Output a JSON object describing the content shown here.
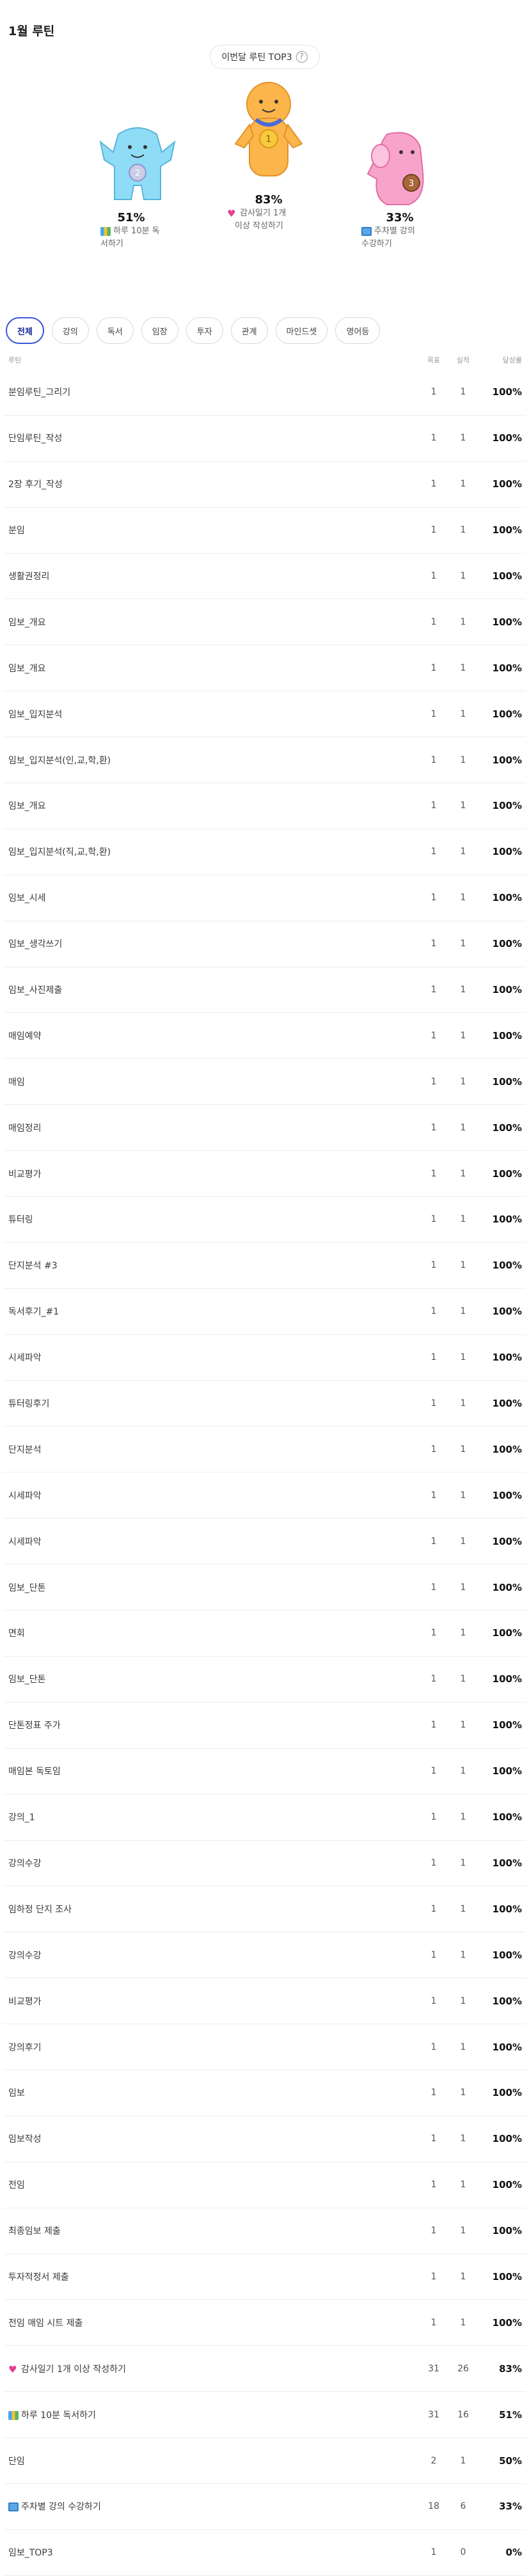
{
  "page_title": "1월 루틴",
  "top3": {
    "pill_label": "이번달 루틴 TOP3",
    "info_icon": "info-icon",
    "first": {
      "rank": "1",
      "percent": "83%",
      "label_line1": "감사일기 1개",
      "label_line2": "이상 작성하기",
      "emoji": "heart",
      "color": "#f5a93a"
    },
    "second": {
      "rank": "2",
      "percent": "51%",
      "label_line1": "하루 10분 독",
      "label_line2": "서하기",
      "emoji": "books",
      "color": "#7fd3f2"
    },
    "third": {
      "rank": "3",
      "percent": "33%",
      "label_line1": "주차별 강의",
      "label_line2": "수강하기",
      "emoji": "screen",
      "color": "#f59ac7"
    }
  },
  "filters": [
    "전체",
    "강의",
    "독서",
    "임장",
    "투자",
    "관계",
    "마인드셋",
    "영어등"
  ],
  "active_filter": "전체",
  "table": {
    "headers": {
      "name": "루틴",
      "goal": "목표",
      "done": "실적",
      "rate": "달성률"
    },
    "rows": [
      {
        "name": "분임루틴_그리기",
        "goal": "1",
        "done": "1",
        "rate": "100%"
      },
      {
        "name": "단임루틴_작성",
        "goal": "1",
        "done": "1",
        "rate": "100%"
      },
      {
        "name": "2장 후기_작성",
        "goal": "1",
        "done": "1",
        "rate": "100%"
      },
      {
        "name": "분임",
        "goal": "1",
        "done": "1",
        "rate": "100%"
      },
      {
        "name": "생활권정리",
        "goal": "1",
        "done": "1",
        "rate": "100%"
      },
      {
        "name": "임보_개요",
        "goal": "1",
        "done": "1",
        "rate": "100%"
      },
      {
        "name": "임보_개요",
        "goal": "1",
        "done": "1",
        "rate": "100%"
      },
      {
        "name": "임보_입지분석",
        "goal": "1",
        "done": "1",
        "rate": "100%"
      },
      {
        "name": "임보_입지분석(인,교,학,환)",
        "goal": "1",
        "done": "1",
        "rate": "100%"
      },
      {
        "name": "임보_개요",
        "goal": "1",
        "done": "1",
        "rate": "100%"
      },
      {
        "name": "임보_입지분석(직,교,학,환)",
        "goal": "1",
        "done": "1",
        "rate": "100%"
      },
      {
        "name": "임보_시세",
        "goal": "1",
        "done": "1",
        "rate": "100%"
      },
      {
        "name": "임보_생각쓰기",
        "goal": "1",
        "done": "1",
        "rate": "100%"
      },
      {
        "name": "임보_사진제출",
        "goal": "1",
        "done": "1",
        "rate": "100%"
      },
      {
        "name": "매임예약",
        "goal": "1",
        "done": "1",
        "rate": "100%"
      },
      {
        "name": "매임",
        "goal": "1",
        "done": "1",
        "rate": "100%"
      },
      {
        "name": "매임정리",
        "goal": "1",
        "done": "1",
        "rate": "100%"
      },
      {
        "name": "비교평가",
        "goal": "1",
        "done": "1",
        "rate": "100%"
      },
      {
        "name": "튜터링",
        "goal": "1",
        "done": "1",
        "rate": "100%"
      },
      {
        "name": "단지분석 #3",
        "goal": "1",
        "done": "1",
        "rate": "100%"
      },
      {
        "name": "독서후기_#1",
        "goal": "1",
        "done": "1",
        "rate": "100%"
      },
      {
        "name": "시세파악",
        "goal": "1",
        "done": "1",
        "rate": "100%"
      },
      {
        "name": "튜터링후기",
        "goal": "1",
        "done": "1",
        "rate": "100%"
      },
      {
        "name": "단지분석",
        "goal": "1",
        "done": "1",
        "rate": "100%"
      },
      {
        "name": "시세파악",
        "goal": "1",
        "done": "1",
        "rate": "100%"
      },
      {
        "name": "시세파악",
        "goal": "1",
        "done": "1",
        "rate": "100%"
      },
      {
        "name": "임보_단톤",
        "goal": "1",
        "done": "1",
        "rate": "100%"
      },
      {
        "name": "면회",
        "goal": "1",
        "done": "1",
        "rate": "100%"
      },
      {
        "name": "임보_단톤",
        "goal": "1",
        "done": "1",
        "rate": "100%"
      },
      {
        "name": "단톤정표 주가",
        "goal": "1",
        "done": "1",
        "rate": "100%"
      },
      {
        "name": "매임본 독토임",
        "goal": "1",
        "done": "1",
        "rate": "100%"
      },
      {
        "name": "강의_1",
        "goal": "1",
        "done": "1",
        "rate": "100%"
      },
      {
        "name": "강의수강",
        "goal": "1",
        "done": "1",
        "rate": "100%"
      },
      {
        "name": "임하정 단지 조사",
        "goal": "1",
        "done": "1",
        "rate": "100%"
      },
      {
        "name": "강의수강",
        "goal": "1",
        "done": "1",
        "rate": "100%"
      },
      {
        "name": "비교평가",
        "goal": "1",
        "done": "1",
        "rate": "100%"
      },
      {
        "name": "강의후기",
        "goal": "1",
        "done": "1",
        "rate": "100%"
      },
      {
        "name": "임보",
        "goal": "1",
        "done": "1",
        "rate": "100%"
      },
      {
        "name": "임보작성",
        "goal": "1",
        "done": "1",
        "rate": "100%"
      },
      {
        "name": "전임",
        "goal": "1",
        "done": "1",
        "rate": "100%"
      },
      {
        "name": "최종임보 제출",
        "goal": "1",
        "done": "1",
        "rate": "100%"
      },
      {
        "name": "투자적정서 제출",
        "goal": "1",
        "done": "1",
        "rate": "100%"
      },
      {
        "name": "전임 매임 시트 제출",
        "goal": "1",
        "done": "1",
        "rate": "100%"
      },
      {
        "name": "감사일기 1개 이상 작성하기",
        "emoji": "heart",
        "goal": "31",
        "done": "26",
        "rate": "83%"
      },
      {
        "name": "하루 10분 독서하기",
        "emoji": "books",
        "goal": "31",
        "done": "16",
        "rate": "51%"
      },
      {
        "name": "단임",
        "goal": "2",
        "done": "1",
        "rate": "50%"
      },
      {
        "name": "주차별 강의 수강하기",
        "emoji": "screen",
        "goal": "18",
        "done": "6",
        "rate": "33%"
      },
      {
        "name": "임보_TOP3",
        "goal": "1",
        "done": "0",
        "rate": "0%"
      }
    ]
  }
}
